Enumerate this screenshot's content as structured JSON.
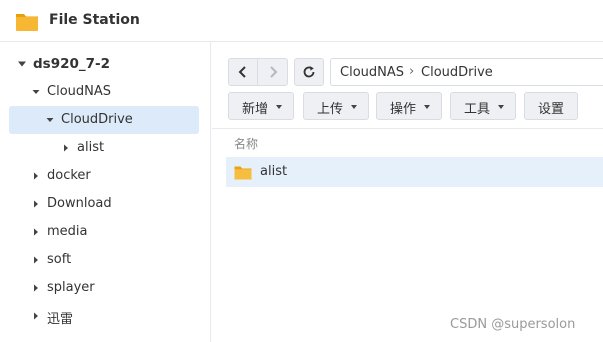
{
  "window": {
    "title": "File Station",
    "icon": "folder-app-icon"
  },
  "sidebar": {
    "items": [
      {
        "label": "ds920_7-2",
        "expanded": true,
        "level": 0
      },
      {
        "label": "CloudNAS",
        "expanded": true,
        "level": 1
      },
      {
        "label": "CloudDrive",
        "expanded": true,
        "level": 2,
        "selected": true
      },
      {
        "label": "alist",
        "expanded": false,
        "level": 3
      },
      {
        "label": "docker",
        "expanded": false,
        "level": 1
      },
      {
        "label": "Download",
        "expanded": false,
        "level": 1
      },
      {
        "label": "media",
        "expanded": false,
        "level": 1
      },
      {
        "label": "soft",
        "expanded": false,
        "level": 1
      },
      {
        "label": "splayer",
        "expanded": false,
        "level": 1
      },
      {
        "label": "迅雷",
        "expanded": false,
        "level": 1
      }
    ]
  },
  "nav": {
    "back_icon": "chevron-left-icon",
    "forward_icon": "chevron-right-icon",
    "refresh_icon": "refresh-icon",
    "path": [
      "CloudNAS",
      "CloudDrive"
    ],
    "separator": "›"
  },
  "toolbar": {
    "buttons": [
      {
        "label": "新增",
        "dropdown": true
      },
      {
        "label": "上传",
        "dropdown": true
      },
      {
        "label": "操作",
        "dropdown": true
      },
      {
        "label": "工具",
        "dropdown": true
      },
      {
        "label": "设置",
        "dropdown": false
      }
    ]
  },
  "file_list": {
    "column_header": "名称",
    "rows": [
      {
        "name": "alist",
        "type": "folder",
        "selected": true
      }
    ]
  },
  "watermark": "CSDN @supersolon",
  "colors": {
    "selection": "#dceafa",
    "row_highlight": "#e6f0fb",
    "folder": "#f5b630",
    "button_bg": "#eef0f3"
  }
}
